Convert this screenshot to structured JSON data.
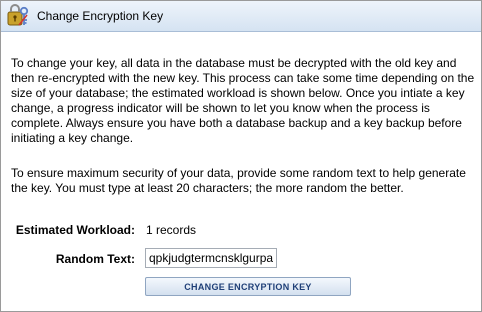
{
  "dialog": {
    "title": "Change Encryption Key",
    "icon": "key-lock-icon"
  },
  "description": {
    "paragraph1": "To change your key, all data in the database must be decrypted with the old key and then re-encrypted with the new key. This process can take some time depending on the size of your database; the estimated workload is shown below. Once you intiate a key change, a progress indicator will be shown to let you know when the process is complete. Always ensure you have both a database backup and a key backup before initiating a key change.",
    "paragraph2": "To ensure maximum security of your data, provide some random text to help generate the key. You must type at least 20 characters; the more random the better."
  },
  "form": {
    "workload_label": "Estimated Workload:",
    "workload_value": "1 records",
    "random_text_label": "Random Text:",
    "random_text_value": "qpkjudgtermcnsklgurpa"
  },
  "actions": {
    "change_key_label": "CHANGE ENCRYPTION KEY"
  }
}
